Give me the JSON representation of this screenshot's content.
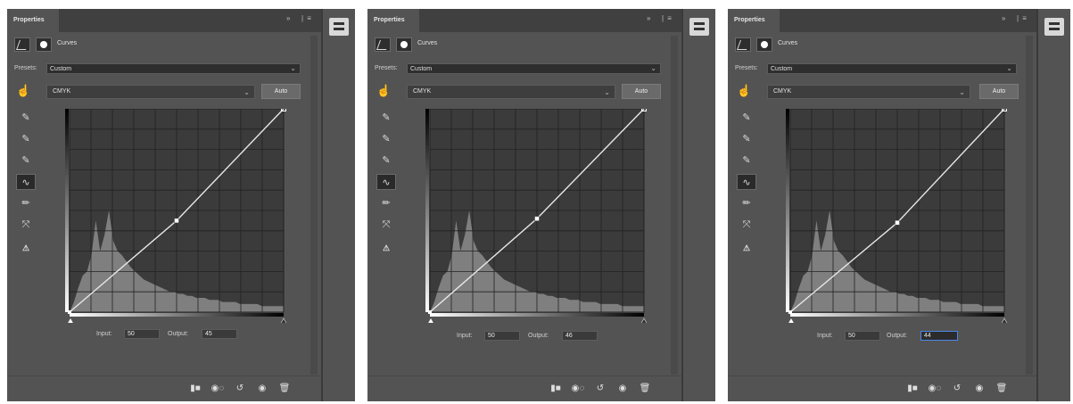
{
  "panels": [
    {
      "tab_title": "Properties",
      "adjustment_label": "Curves",
      "presets_label": "Presets:",
      "preset_value": "Custom",
      "channel_value": "CMYK",
      "auto_label": "Auto",
      "input_label": "Input:",
      "input_value": "50",
      "output_label": "Output:",
      "output_value": "45",
      "output_focused": false,
      "curve": {
        "input": 50,
        "output": 45
      }
    },
    {
      "tab_title": "Properties",
      "adjustment_label": "Curves",
      "presets_label": "Presets:",
      "preset_value": "Custom",
      "channel_value": "CMYK",
      "auto_label": "Auto",
      "input_label": "Input:",
      "input_value": "50",
      "output_label": "Output:",
      "output_value": "46",
      "output_focused": false,
      "curve": {
        "input": 50,
        "output": 46
      }
    },
    {
      "tab_title": "Properties",
      "adjustment_label": "Curves",
      "presets_label": "Presets:",
      "preset_value": "Custom",
      "channel_value": "CMYK",
      "auto_label": "Auto",
      "input_label": "Input:",
      "input_value": "50",
      "output_label": "Output:",
      "output_value": "44",
      "output_focused": true,
      "curve": {
        "input": 50,
        "output": 44
      }
    }
  ],
  "icons": {
    "panel_menu": "panel-menu-icon",
    "collapse": "collapse-icon",
    "adjustments": "adjustments-panel-icon",
    "tools": [
      "targeted-adjustment-icon",
      "black-point-eyedropper-icon",
      "gray-point-eyedropper-icon",
      "white-point-eyedropper-icon",
      "curve-edit-icon",
      "pencil-icon",
      "smooth-icon",
      "clipping-warning-icon"
    ],
    "bottom": [
      "clip-to-layer-icon",
      "view-previous-icon",
      "reset-icon",
      "visibility-icon",
      "delete-icon"
    ]
  },
  "colors": {
    "panel_bg": "#535353",
    "graph_bg": "#3b3b3b",
    "curve": "#e8e8e8",
    "histogram": "#8c8c8c",
    "focus_ring": "#4a86e8"
  }
}
